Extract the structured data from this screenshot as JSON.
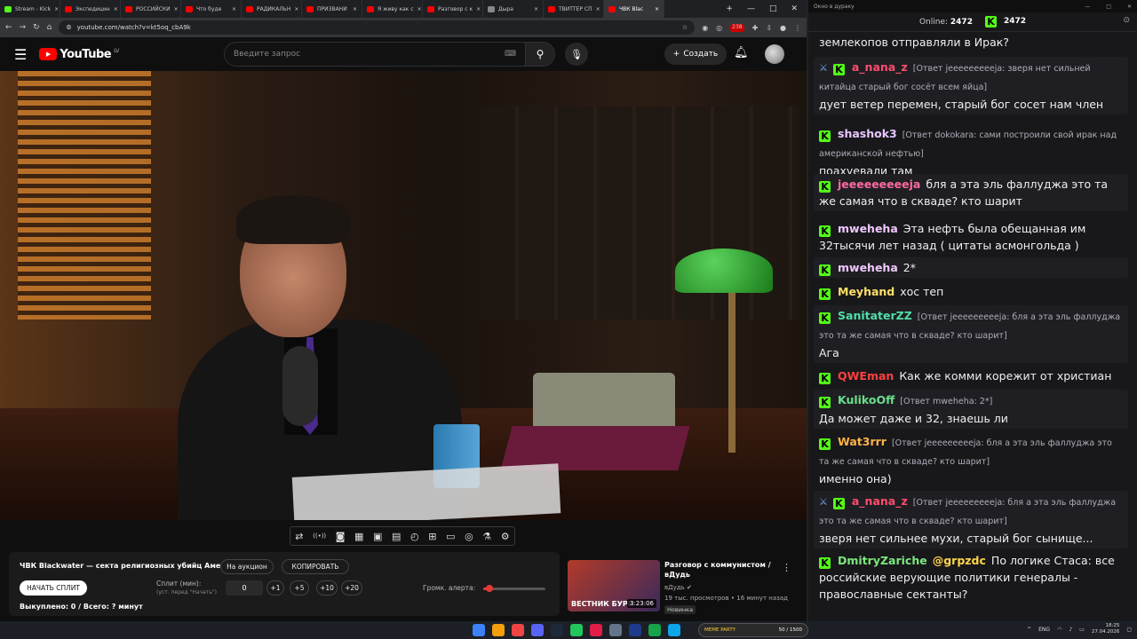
{
  "browser": {
    "tabs": [
      {
        "label": "Stream - Kick",
        "color": "#53fc18",
        "active": false
      },
      {
        "label": "Экспедицин",
        "color": "#ff0000",
        "active": false
      },
      {
        "label": "РОССИЙСКИ",
        "color": "#ff0000",
        "active": false
      },
      {
        "label": "Что буде",
        "color": "#ff0000",
        "active": false
      },
      {
        "label": "РАДИКАЛЬН",
        "color": "#ff0000",
        "active": false
      },
      {
        "label": "ПРИЗВАНИ",
        "color": "#ff0000",
        "active": false
      },
      {
        "label": "Я живу как с",
        "color": "#ff0000",
        "active": false
      },
      {
        "label": "Разговор с к",
        "color": "#ff0000",
        "active": false
      },
      {
        "label": "Дыра",
        "color": "#888888",
        "active": false
      },
      {
        "label": "ТВИТТЕР СП",
        "color": "#ff0000",
        "active": false
      },
      {
        "label": "ЧВК Blac",
        "color": "#ff0000",
        "active": true
      }
    ],
    "url": "youtube.com/watch?v=kt5oq_cbA9k",
    "ext_badge": "238"
  },
  "youtube": {
    "logo_text": "YouTube",
    "region": "LV",
    "search_placeholder": "Введите запрос",
    "create_label": "Создать"
  },
  "toolbar_icons": [
    "loop-icon",
    "broadcast-icon",
    "camera-record-icon",
    "clapper-icon",
    "picture-in-picture-icon",
    "film-strip-icon",
    "speed-icon",
    "add-clip-icon",
    "screen-rec-icon",
    "screenshot-icon",
    "flask-icon",
    "settings-icon"
  ],
  "panel": {
    "title": "ЧВК Blackwater — секта религиозных убийц Америки!",
    "auction_label": "На аукцион",
    "copy_label": "КОПИРОВАТЬ",
    "start_split_label": "НАЧАТЬ СПЛИТ",
    "split_label": "Сплит (мин):",
    "split_hint": "(уст. перед \"Начать\")",
    "split_value": "0",
    "increments": [
      "+1",
      "+5",
      "+10",
      "+20"
    ],
    "alert_label": "Громк. алерта:",
    "alert_volume": 0.1,
    "bought": "Выкуплено: 0 / Всего: ? минут"
  },
  "recommendation": {
    "title": "Разговор с коммунистом / вДудь",
    "thumb_text": "ВЕСТНИК БУРИ",
    "duration": "3:23:06",
    "channel": "вДудь",
    "meta": "19 тыс. просмотров • 16 минут назад",
    "badge": "Новинка"
  },
  "chat": {
    "window_title": "Окно в дураку",
    "online_label": "Online:",
    "online_count": "2472",
    "viewer_count": "2472",
    "messages": [
      {
        "user": "",
        "color": "#ffffff",
        "reply": "",
        "text": "землекопов отправляли в Ирак?",
        "sword": false,
        "badge": false
      },
      {
        "user": "a_nana_z",
        "color": "#ff4d6d",
        "reply": "[Ответ jeeeeeeeeeja: зверя нет сильней китайца старый бог сосёт всем яйца]",
        "text": "дует ветер перемен, старый бог сосет нам член",
        "sword": true,
        "badge": true
      },
      {
        "user": "shashok3",
        "color": "#e8c8ff",
        "reply": "[Ответ dokokara: сами построили свой ирак над американской нефтью]",
        "text": "поахуевали там",
        "sword": false,
        "badge": true
      },
      {
        "user": "jeeeeeeeeeja",
        "color": "#ff6aa0",
        "reply": "",
        "text": "бля а эта эль фаллуджа это та же самая что в скваде? кто шарит",
        "sword": false,
        "badge": true
      },
      {
        "user": "mweheha",
        "color": "#f0c8ff",
        "reply": "",
        "text": "Эта нефть была обещанная им 32тысячи лет назад ( цитаты асмонгольда )",
        "sword": false,
        "badge": true
      },
      {
        "user": "mweheha",
        "color": "#f0c8ff",
        "reply": "",
        "text": "2*",
        "sword": false,
        "badge": true
      },
      {
        "user": "Meyhand",
        "color": "#ffe066",
        "reply": "",
        "text": "хос теп",
        "sword": false,
        "badge": true
      },
      {
        "user": "SanitaterZZ",
        "color": "#4ee0a8",
        "reply": "[Ответ jeeeeeeeeeja: бля а эта эль фаллуджа это та же самая что в скваде? кто шарит]",
        "text": "Ага",
        "sword": false,
        "badge": true
      },
      {
        "user": "QWEman",
        "color": "#ff4040",
        "reply": "",
        "text": "Как же комми корежит от христиан",
        "sword": false,
        "badge": true
      },
      {
        "user": "KulikoOff",
        "color": "#6ae08a",
        "reply": "[Ответ mweheha: 2*]",
        "text": "Да может даже и 32, знаешь ли",
        "sword": false,
        "badge": true
      },
      {
        "user": "Wat3rrr",
        "color": "#ffb347",
        "reply": "[Ответ jeeeeeeeeeja: бля а эта эль фаллуджа это та же самая что в скваде? кто шарит]",
        "text": "именно она)",
        "sword": false,
        "badge": true
      },
      {
        "user": "a_nana_z",
        "color": "#ff4d6d",
        "reply": "[Ответ jeeeeeeeeeja: бля а эта эль фаллуджа это та же самая что в скваде? кто шарит]",
        "text": "зверя нет сильнее мухи, старый бог сынище...",
        "sword": true,
        "badge": true
      },
      {
        "user": "DmitryZariche",
        "color": "#7de87d",
        "reply": "",
        "mention": "@grpzdc",
        "text": "По логике Стаса: все российские верующие политики генералы - православные сектанты?",
        "sword": false,
        "badge": true
      }
    ]
  },
  "taskbar": {
    "meme_label": "MEME PARTY",
    "meme_count": "50 / 1500",
    "lang": "ENG",
    "time": "18:25",
    "date": "27.04.2026"
  }
}
